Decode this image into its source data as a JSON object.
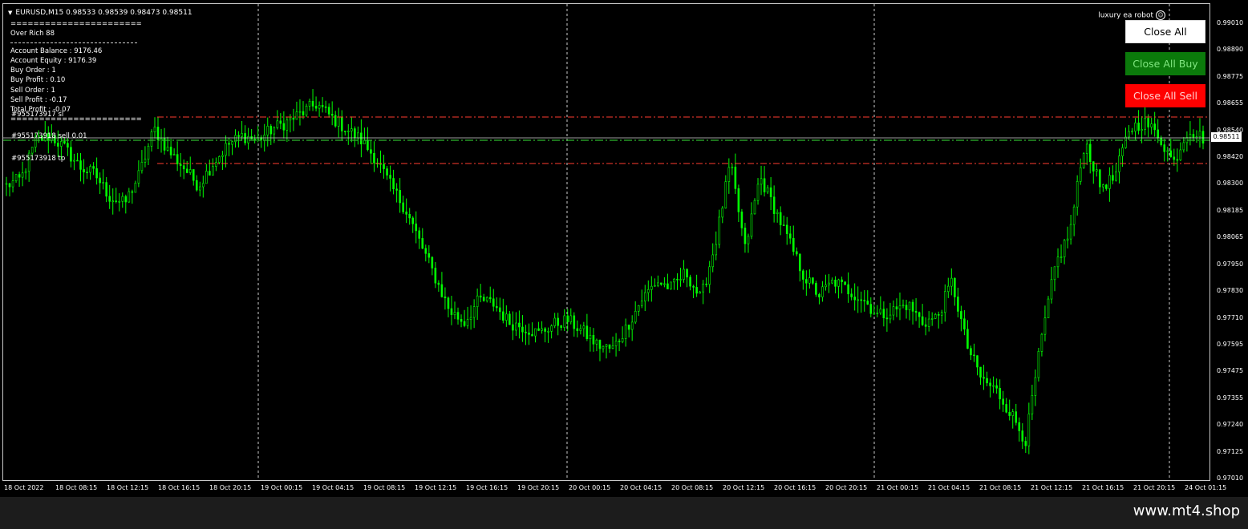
{
  "header": {
    "symbol_line": "EURUSD,M15  0.98533 0.98539 0.98473 0.98511"
  },
  "info_panel": {
    "separator_top": "=======================",
    "ea_name": "Over Rich 88",
    "separator_mid": "------------------------------------------------",
    "account_balance": "Account Balance : 9176.46",
    "account_equity": "Account Equity : 9176.39",
    "buy_order": "Buy Order : 1",
    "buy_profit": "Buy Profit : 0.10",
    "sell_order": "Sell Order : 1",
    "sell_profit": "Sell Profit : -0.17",
    "total_profit": "Total Profit : -0.07",
    "separator_bottom": "======================="
  },
  "order_labels": {
    "sl_label": "#955173917 sl",
    "order_label": "#955173918 sell 0.01",
    "tp_label": "#955173918 tp"
  },
  "ea_panel": {
    "title": "luxury ea robot",
    "close_all": "Close All",
    "close_all_buy": "Close All Buy",
    "close_all_sell": "Close All Sell"
  },
  "price_axis": {
    "ticks": [
      "0.99010",
      "0.98890",
      "0.98775",
      "0.98655",
      "0.98540",
      "0.98420",
      "0.98300",
      "0.98185",
      "0.98065",
      "0.97950",
      "0.97830",
      "0.97710",
      "0.97595",
      "0.97475",
      "0.97355",
      "0.97240",
      "0.97125",
      "0.97010"
    ],
    "current_price": "0.98511"
  },
  "time_axis": {
    "ticks": [
      "18 Oct 2022",
      "18 Oct 08:15",
      "18 Oct 12:15",
      "18 Oct 16:15",
      "18 Oct 20:15",
      "19 Oct 00:15",
      "19 Oct 04:15",
      "19 Oct 08:15",
      "19 Oct 12:15",
      "19 Oct 16:15",
      "19 Oct 20:15",
      "20 Oct 00:15",
      "20 Oct 04:15",
      "20 Oct 08:15",
      "20 Oct 12:15",
      "20 Oct 16:15",
      "20 Oct 20:15",
      "21 Oct 00:15",
      "21 Oct 04:15",
      "21 Oct 08:15",
      "21 Oct 12:15",
      "21 Oct 16:15",
      "21 Oct 20:15",
      "24 Oct 01:15"
    ]
  },
  "colors": {
    "candle": "#00ff00",
    "background": "#000000",
    "sl_tp_line": "#ff3b30",
    "order_line": "#2eb82e",
    "grid_line": "#ffffff"
  },
  "watermark": "www.mt4.shop",
  "chart_data": {
    "type": "line",
    "series": [
      {
        "values": [
          0.983,
          0.9833,
          0.985,
          0.9852,
          0.9846,
          0.9838,
          0.9835,
          0.9825,
          0.9822,
          0.9835,
          0.9855,
          0.9845,
          0.9838,
          0.983,
          0.984,
          0.9848,
          0.9852,
          0.985,
          0.9855,
          0.9858,
          0.9862,
          0.9866,
          0.986,
          0.9855,
          0.985,
          0.9842,
          0.983,
          0.982,
          0.9805,
          0.979,
          0.9775,
          0.977,
          0.978,
          0.9778,
          0.977,
          0.9768,
          0.9765,
          0.9769,
          0.9771,
          0.9766,
          0.976,
          0.9758,
          0.9768,
          0.978,
          0.9788,
          0.9785,
          0.9792,
          0.978,
          0.9805,
          0.984,
          0.9802,
          0.9834,
          0.982,
          0.9805,
          0.979,
          0.9782,
          0.9788,
          0.9784,
          0.978,
          0.9773,
          0.9775,
          0.9778,
          0.977,
          0.9772,
          0.9788,
          0.976,
          0.9745,
          0.974,
          0.973,
          0.9718,
          0.976,
          0.9795,
          0.981,
          0.985,
          0.983,
          0.9833,
          0.9855,
          0.9858,
          0.9852,
          0.984,
          0.9855,
          0.9851
        ],
        "range": {
          "open": 0.98533,
          "high": 0.98539,
          "low": 0.98473,
          "close": 0.98511
        }
      }
    ],
    "ylim": [
      0.9701,
      0.9901
    ],
    "grid": "dashed vertical day separators"
  }
}
